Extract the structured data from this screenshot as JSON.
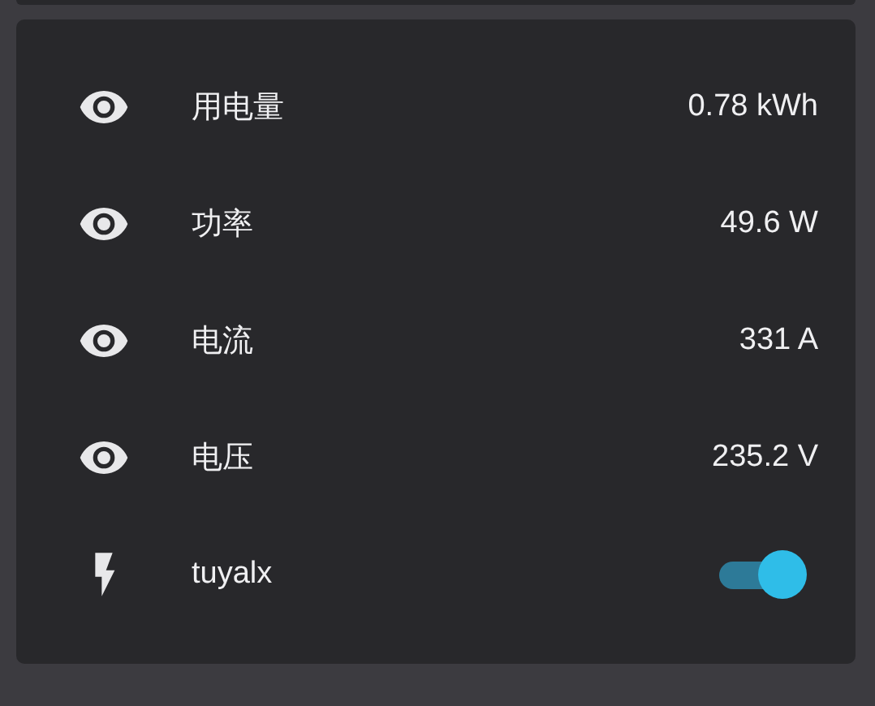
{
  "entities": [
    {
      "kind": "sensor",
      "name": "用电量",
      "value": "0.78 kWh"
    },
    {
      "kind": "sensor",
      "name": "功率",
      "value": "49.6 W"
    },
    {
      "kind": "sensor",
      "name": "电流",
      "value": "331 A"
    },
    {
      "kind": "sensor",
      "name": "电压",
      "value": "235.2 V"
    },
    {
      "kind": "switch",
      "name": "tuyalx",
      "on": true
    }
  ]
}
